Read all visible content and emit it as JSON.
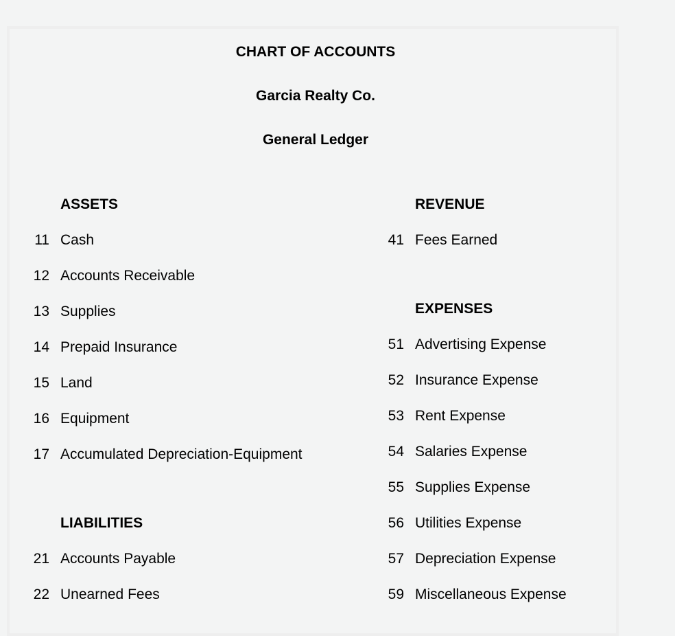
{
  "header": {
    "title": "CHART OF ACCOUNTS",
    "company": "Garcia Realty Co.",
    "ledger": "General Ledger"
  },
  "left": [
    {
      "heading": "ASSETS",
      "accounts": [
        {
          "no": "11",
          "name": "Cash"
        },
        {
          "no": "12",
          "name": "Accounts Receivable"
        },
        {
          "no": "13",
          "name": "Supplies"
        },
        {
          "no": "14",
          "name": "Prepaid Insurance"
        },
        {
          "no": "15",
          "name": "Land"
        },
        {
          "no": "16",
          "name": "Equipment"
        },
        {
          "no": "17",
          "name": "Accumulated Depreciation-Equipment"
        }
      ]
    },
    {
      "heading": "LIABILITIES",
      "accounts": [
        {
          "no": "21",
          "name": "Accounts Payable"
        },
        {
          "no": "22",
          "name": "Unearned Fees"
        }
      ]
    }
  ],
  "right": [
    {
      "heading": "REVENUE",
      "accounts": [
        {
          "no": "41",
          "name": "Fees Earned"
        }
      ]
    },
    {
      "heading": "EXPENSES",
      "accounts": [
        {
          "no": "51",
          "name": "Advertising Expense"
        },
        {
          "no": "52",
          "name": "Insurance Expense"
        },
        {
          "no": "53",
          "name": "Rent Expense"
        },
        {
          "no": "54",
          "name": "Salaries Expense"
        },
        {
          "no": "55",
          "name": "Supplies Expense"
        },
        {
          "no": "56",
          "name": "Utilities Expense"
        },
        {
          "no": "57",
          "name": "Depreciation Expense"
        },
        {
          "no": "59",
          "name": "Miscellaneous Expense"
        }
      ]
    }
  ]
}
